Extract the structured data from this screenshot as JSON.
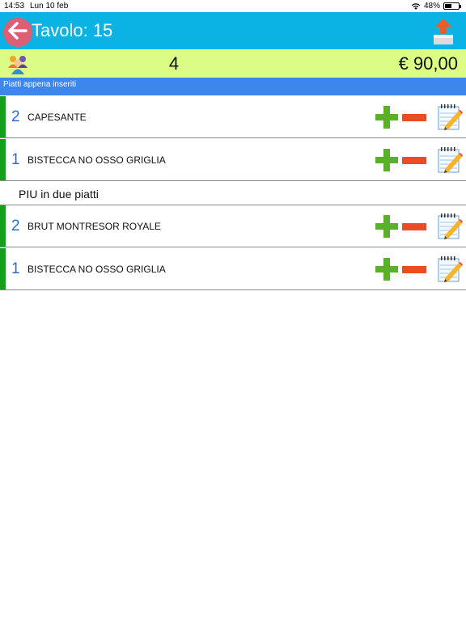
{
  "status_bar": {
    "time": "14:53",
    "date": "Lun 10 feb",
    "battery": "48%",
    "battery_level": 0.48
  },
  "header": {
    "title": "Tavolo: 15",
    "back_icon": "arrow-left-icon",
    "upload_icon": "upload-icon",
    "bg_color": "#0bb3e4"
  },
  "summary": {
    "people_icon": "people-icon",
    "covers": "4",
    "total": "€ 90,00",
    "bg_color": "#dcfd85"
  },
  "section": {
    "label": "Piatti appena inseriti",
    "bg_color": "#3d86ee"
  },
  "items_top": [
    {
      "qty": "2",
      "name": "CAPESANTE"
    },
    {
      "qty": "1",
      "name": "BISTECCA NO OSSO GRIGLIA"
    }
  ],
  "group": {
    "label": "PIU in due piatti"
  },
  "items_bottom": [
    {
      "qty": "2",
      "name": "BRUT MONTRESOR ROYALE"
    },
    {
      "qty": "1",
      "name": "BISTECCA NO OSSO GRIGLIA"
    }
  ],
  "colors": {
    "plus": "#5bb02a",
    "minus": "#ea4c25",
    "stripe": "#16a019",
    "qty": "#2f6dbd"
  }
}
